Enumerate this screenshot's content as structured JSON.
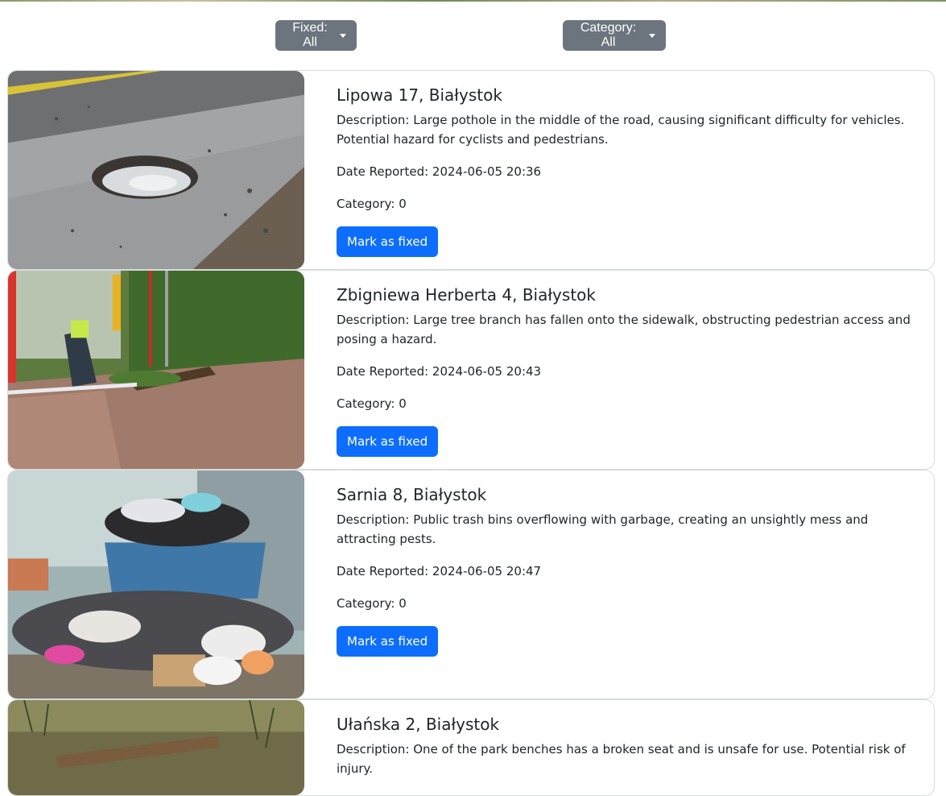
{
  "filters": {
    "fixed_label": "Fixed: All",
    "category_label": "Category: All"
  },
  "reports": [
    {
      "address": "Lipowa 17, Białystok",
      "description": "Description: Large pothole in the middle of the road, causing significant difficulty for vehicles. Potential hazard for cyclists and pedestrians.",
      "date": "Date Reported: 2024-06-05 20:36",
      "category": "Category: 0",
      "button": "Mark as fixed",
      "image": "pothole-photo"
    },
    {
      "address": "Zbigniewa Herberta 4, Białystok",
      "description": "Description: Large tree branch has fallen onto the sidewalk, obstructing pedestrian access and posing a hazard.",
      "date": "Date Reported: 2024-06-05 20:43",
      "category": "Category: 0",
      "button": "Mark as fixed",
      "image": "fallen-branch-photo"
    },
    {
      "address": "Sarnia 8, Białystok",
      "description": "Description: Public trash bins overflowing with garbage, creating an unsightly mess and attracting pests.",
      "date": "Date Reported: 2024-06-05 20:47",
      "category": "Category: 0",
      "button": "Mark as fixed",
      "image": "overflowing-trash-photo"
    },
    {
      "address": "Ułańska 2, Białystok",
      "description": "Description: One of the park benches has a broken seat and is unsafe for use. Potential risk of injury.",
      "image": "broken-bench-photo"
    }
  ],
  "colors": {
    "filter_button": "#6c757d",
    "primary_button": "#0d6efd",
    "card_border": "#d7dadd"
  }
}
